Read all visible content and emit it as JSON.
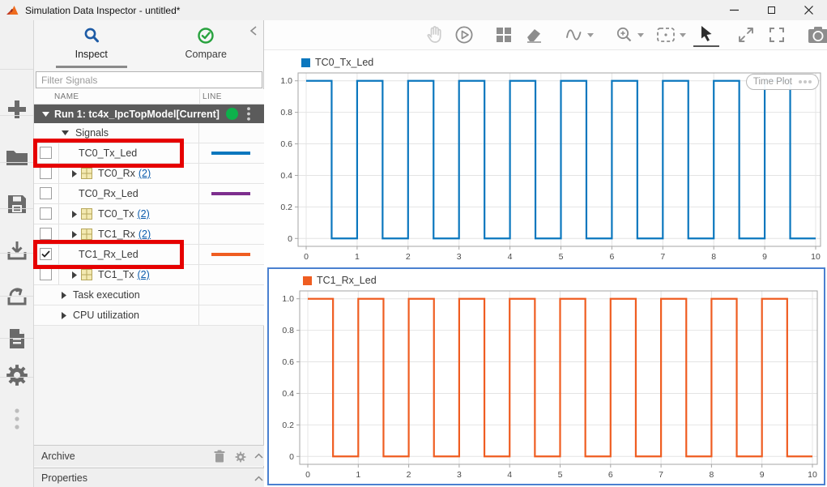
{
  "window": {
    "title": "Simulation Data Inspector - untitled*",
    "controls": {
      "minimize": "minimize",
      "maximize": "maximize",
      "close": "close"
    }
  },
  "left_toolbar": {
    "items": [
      "add",
      "open",
      "save",
      "import",
      "export",
      "report",
      "settings",
      "more"
    ]
  },
  "tabs": {
    "inspect": {
      "label": "Inspect",
      "icon": "search-icon",
      "active": true
    },
    "compare": {
      "label": "Compare",
      "icon": "compare-check-icon",
      "active": false
    }
  },
  "filter": {
    "placeholder": "Filter Signals"
  },
  "table": {
    "columns": [
      "NAME",
      "LINE"
    ],
    "run_header": {
      "label": "Run 1: tc4x_IpcTopModel[Current]",
      "status_color": "#0db14b"
    },
    "rows": [
      {
        "kind": "group",
        "label": "Signals",
        "expanded": true
      },
      {
        "kind": "signal",
        "label": "TC0_Tx_Led",
        "checked": false,
        "line_color": "#0b77be",
        "annotated": true
      },
      {
        "kind": "bus",
        "label": "TC0_Rx",
        "count": "(2)",
        "checked": false
      },
      {
        "kind": "signal",
        "label": "TC0_Rx_Led",
        "checked": false,
        "line_color": "#7d2e8e",
        "annotated": false
      },
      {
        "kind": "bus",
        "label": "TC0_Tx",
        "count": "(2)",
        "checked": false
      },
      {
        "kind": "bus",
        "label": "TC1_Rx",
        "count": "(2)",
        "checked": false
      },
      {
        "kind": "signal",
        "label": "TC1_Rx_Led",
        "checked": true,
        "line_color": "#ef5d21",
        "annotated": true
      },
      {
        "kind": "bus",
        "label": "TC1_Tx",
        "count": "(2)",
        "checked": false
      },
      {
        "kind": "group",
        "label": "Task execution",
        "expanded": false
      },
      {
        "kind": "group",
        "label": "CPU utilization",
        "expanded": false
      }
    ]
  },
  "archive": {
    "label": "Archive"
  },
  "properties": {
    "label": "Properties"
  },
  "top_toolbar": {
    "items": [
      {
        "sep": true
      },
      {
        "icon": "pan",
        "disabled": true
      },
      {
        "icon": "replay"
      },
      {
        "sep": true
      },
      {
        "icon": "layout"
      },
      {
        "icon": "eraser"
      },
      {
        "sep": true
      },
      {
        "icon": "signal-wave",
        "dropdown": true
      },
      {
        "sep": true
      },
      {
        "icon": "zoom-in",
        "dropdown": true
      },
      {
        "icon": "zoom-region",
        "dropdown": true
      },
      {
        "icon": "cursor",
        "selected": true
      },
      {
        "sep": true
      },
      {
        "icon": "fit-view"
      },
      {
        "icon": "fullscreen"
      },
      {
        "sep": true
      },
      {
        "icon": "snapshot"
      },
      {
        "icon": "plot-settings"
      }
    ]
  },
  "chart_data": [
    {
      "type": "line",
      "subtype": "square_wave",
      "title": "TC0_Tx_Led",
      "legend": "TC0_Tx_Led",
      "color": "#0b77be",
      "xlim": [
        0,
        10
      ],
      "ylim": [
        -0.05,
        1.05
      ],
      "x_ticks": [
        [
          0,
          "0"
        ],
        [
          1,
          "1"
        ],
        [
          2,
          "2"
        ],
        [
          3,
          "3"
        ],
        [
          4,
          "4"
        ],
        [
          5,
          "5"
        ],
        [
          6,
          "6"
        ],
        [
          7,
          "7"
        ],
        [
          8,
          "8"
        ],
        [
          9,
          "9"
        ],
        [
          10,
          "10"
        ]
      ],
      "y_ticks": [
        [
          1,
          "1.0"
        ],
        [
          0.8,
          "0.8"
        ],
        [
          0.6,
          "0.6"
        ],
        [
          0.4,
          "0.4"
        ],
        [
          0.2,
          "0.2"
        ],
        [
          0,
          "0"
        ]
      ],
      "grid": true,
      "wave": {
        "t_start": 0,
        "t_end": 10,
        "period": 1,
        "duty_high": 0.5,
        "high": 1,
        "low": 0,
        "start_level": "high"
      },
      "badge": "Time Plot",
      "selected": false
    },
    {
      "type": "line",
      "subtype": "square_wave",
      "title": "TC1_Rx_Led",
      "legend": "TC1_Rx_Led",
      "color": "#ef5d21",
      "xlim": [
        0,
        10
      ],
      "ylim": [
        -0.05,
        1.05
      ],
      "x_ticks": [
        [
          0,
          "0"
        ],
        [
          1,
          "1"
        ],
        [
          2,
          "2"
        ],
        [
          3,
          "3"
        ],
        [
          4,
          "4"
        ],
        [
          5,
          "5"
        ],
        [
          6,
          "6"
        ],
        [
          7,
          "7"
        ],
        [
          8,
          "8"
        ],
        [
          9,
          "9"
        ],
        [
          10,
          "10"
        ]
      ],
      "y_ticks": [
        [
          1,
          "1.0"
        ],
        [
          0.8,
          "0.8"
        ],
        [
          0.6,
          "0.6"
        ],
        [
          0.4,
          "0.4"
        ],
        [
          0.2,
          "0.2"
        ],
        [
          0,
          "0"
        ]
      ],
      "grid": true,
      "wave": {
        "t_start": 0,
        "t_end": 10,
        "period": 1,
        "duty_high": 0.5,
        "high": 1,
        "low": 0,
        "start_level": "high"
      },
      "badge": null,
      "selected": true
    }
  ],
  "colors": {
    "annotation_red": "#e60000",
    "selection_blue": "#4a80d0",
    "run_header_bg": "#5b5b5b",
    "status_green": "#0db14b",
    "inspect_icon_blue": "#1d5ba5",
    "compare_icon_green": "#28a23e",
    "link_blue": "#0b5cad"
  }
}
